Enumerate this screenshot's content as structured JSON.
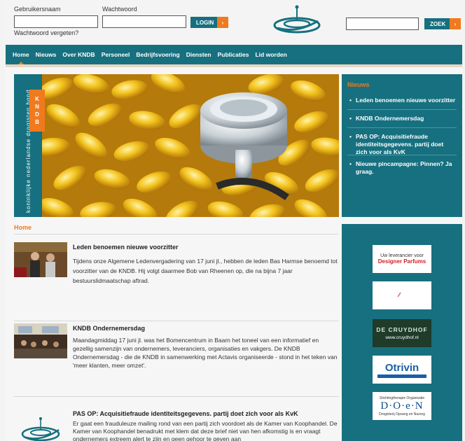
{
  "login": {
    "username_label": "Gebruikersnaam",
    "password_label": "Wachtwoord",
    "login_button": "LOGIN",
    "forgot_password": "Wachtwoord vergeten?",
    "search_button": "ZOEK",
    "arrow": "›"
  },
  "nav": {
    "items": [
      "Home",
      "Nieuws",
      "Over KNDB",
      "Personeel",
      "Bedrijfsvoering",
      "Diensten",
      "Publicaties",
      "Lid worden"
    ]
  },
  "banner": {
    "vertical_text": "koninklijke nederlandse drogisten bond",
    "tag": [
      "K",
      "N",
      "D",
      "B"
    ]
  },
  "newsbox": {
    "title": "Nieuws",
    "items": [
      "Leden benoemen nieuwe voorzitter",
      "KNDB Ondernemersdag",
      "PAS OP: Acquisitiefraude identiteitsgegevens. partij doet zich voor als KvK",
      "Nieuwe pincampagne: Pinnen? Ja graag."
    ]
  },
  "breadcrumb": "Home",
  "articles": [
    {
      "title": "Leden benoemen nieuwe voorzitter",
      "body": "Tijdens onze Algemene Ledenvergadering van 17 juni jl., hebben de leden Bas Harmse benoemd tot voorzitter van de KNDB. Hij volgt daarmee Bob van Rheenen op, die na bijna 7 jaar bestuurslidmaatschap aftrad."
    },
    {
      "title": "KNDB Ondernemersdag",
      "body": "Maandagmiddag 17 juni jl. was het Bomencentrum in Baarn het toneel van een informatief en gezellig samenzijn van ondernemers, leveranciers, organisaties en vakgers. De KNDB Ondernemersdag - die de KNDB in samenwerking met Actavis organiseerde - stond in het teken van 'meer klanten, meer omzet'."
    },
    {
      "title": "PAS OP: Acquisitiefraude identiteitsgegevens. partij doet zich voor als KvK",
      "body": "Er gaat een frauduleuze mailing rond van een partij zich voordoet als de Kamer van Koophandel. De Kamer van Koophandel benadrukt met klem dat deze brief niet van hen afkomstig is en vraagt ondernemers extreem alert te zijn en geen gehoor te geven aan"
    }
  ],
  "sponsors": {
    "s1_line1": "Uw leverancier voor",
    "s1_line2": "Designer Parfums",
    "s3_line1": "DE CRUYDHOF",
    "s3_line2": "www.cruydhof.nl",
    "s4_line1": "Otrivin",
    "s5_line0": "Stichtingtherapie Organisatie",
    "s5_line1": "D·O·e·N",
    "s5_line2": "Drogisterij Opvang en Nazorg"
  },
  "colors": {
    "teal": "#16707f",
    "orange": "#f07a1e"
  }
}
